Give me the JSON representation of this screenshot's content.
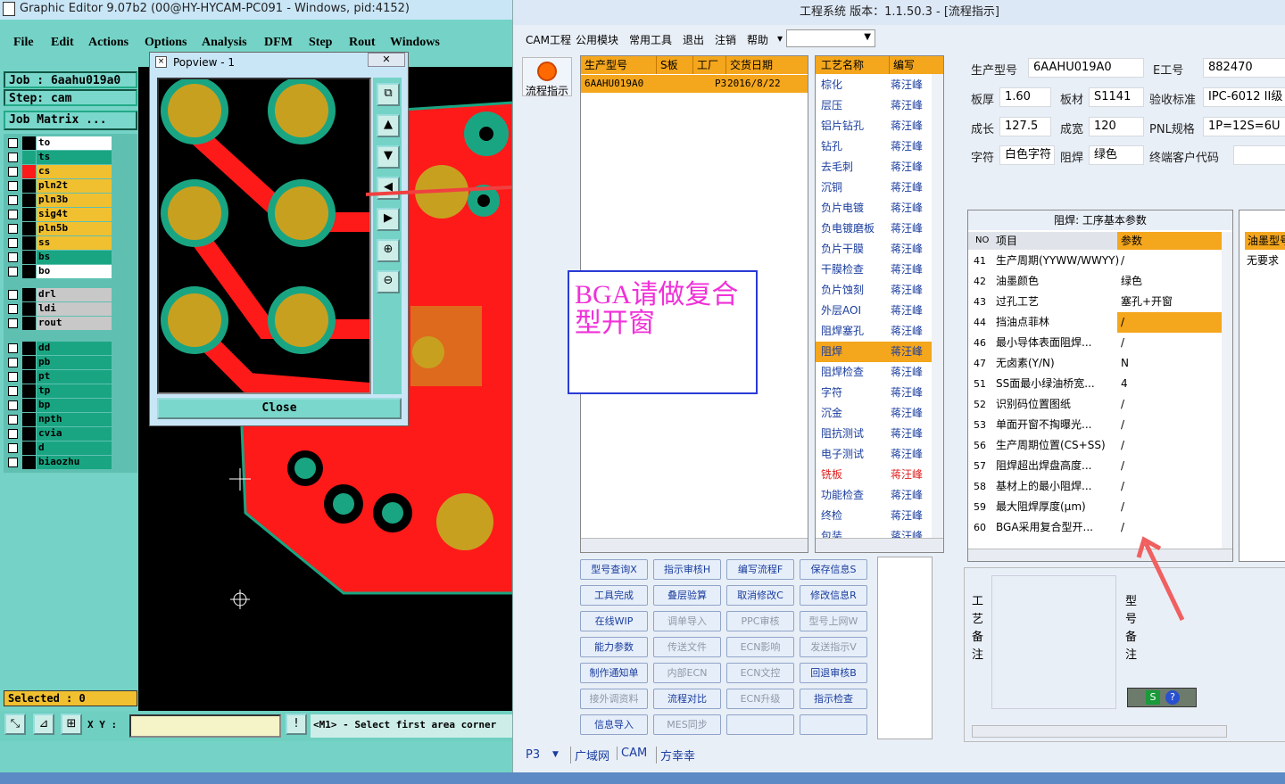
{
  "left_app": {
    "title": "Graphic Editor 9.07b2 (00@HY-HYCAM-PC091 - Windows, pid:4152)",
    "menu": [
      "File",
      "Edit",
      "Actions",
      "Options",
      "Analysis",
      "DFM",
      "Step",
      "Rout",
      "Windows"
    ],
    "job": "Job :  6aahu019a0",
    "step": "Step: cam",
    "job_matrix": "Job Matrix ...",
    "layers_top": [
      {
        "name": "to",
        "color": "#ffffff",
        "swatch": "#000000"
      },
      {
        "name": "ts",
        "color": "#1aa582",
        "swatch": "#1aa582"
      },
      {
        "name": "cs",
        "color": "#f0c030",
        "swatch": "#ff1a1a"
      },
      {
        "name": "pln2t",
        "color": "#f0c030",
        "swatch": "#000000"
      },
      {
        "name": "pln3b",
        "color": "#f0c030",
        "swatch": "#000000"
      },
      {
        "name": "sig4t",
        "color": "#f0c030",
        "swatch": "#000000"
      },
      {
        "name": "pln5b",
        "color": "#f0c030",
        "swatch": "#000000"
      },
      {
        "name": "ss",
        "color": "#f0c030",
        "swatch": "#000000"
      },
      {
        "name": "bs",
        "color": "#1aa582",
        "swatch": "#000000"
      },
      {
        "name": "bo",
        "color": "#ffffff",
        "swatch": "#000000"
      }
    ],
    "layers_drill": [
      {
        "name": "drl",
        "color": "#c8c8c8",
        "swatch": "#000000"
      },
      {
        "name": "ldi",
        "color": "#c8c8c8",
        "swatch": "#000000"
      },
      {
        "name": "rout",
        "color": "#c8c8c8",
        "swatch": "#000000"
      }
    ],
    "layers_misc": [
      {
        "name": "dd",
        "color": "#1aa582",
        "swatch": "#000000"
      },
      {
        "name": "pb",
        "color": "#1aa582",
        "swatch": "#000000"
      },
      {
        "name": "pt",
        "color": "#1aa582",
        "swatch": "#000000"
      },
      {
        "name": "tp",
        "color": "#1aa582",
        "swatch": "#000000"
      },
      {
        "name": "bp",
        "color": "#1aa582",
        "swatch": "#000000"
      },
      {
        "name": "npth",
        "color": "#1aa582",
        "swatch": "#000000"
      },
      {
        "name": "cvia",
        "color": "#1aa582",
        "swatch": "#000000"
      },
      {
        "name": "d",
        "color": "#1aa582",
        "swatch": "#000000"
      },
      {
        "name": "biaozhu",
        "color": "#1aa582",
        "swatch": "#000000"
      }
    ],
    "selected": "Selected : 0",
    "xy_label": "X Y :",
    "status": "<M1> - Select first area corner"
  },
  "popview": {
    "title": "Popview - 1",
    "close": "Close"
  },
  "erp": {
    "title": "工程系统  版本：1.1.50.3 - [流程指示]",
    "menu": [
      "CAM工程",
      "公用模块",
      "常用工具",
      "退出",
      "注销",
      "帮助"
    ],
    "flow_button": "流程指示",
    "orders_header": [
      "生产型号",
      "S板",
      "工厂",
      "交货日期"
    ],
    "orders": [
      {
        "model": "6AAHU019A0",
        "s": "",
        "factory": "P3",
        "date": "2016/8/22"
      }
    ],
    "process_header": [
      "工艺名称",
      "编写"
    ],
    "processes": [
      {
        "name": "棕化",
        "who": "蒋汪峰"
      },
      {
        "name": "层压",
        "who": "蒋汪峰"
      },
      {
        "name": "铝片钻孔",
        "who": "蒋汪峰"
      },
      {
        "name": "钻孔",
        "who": "蒋汪峰"
      },
      {
        "name": "去毛刺",
        "who": "蒋汪峰"
      },
      {
        "name": "沉铜",
        "who": "蒋汪峰"
      },
      {
        "name": "负片电镀",
        "who": "蒋汪峰"
      },
      {
        "name": "负电镀磨板",
        "who": "蒋汪峰"
      },
      {
        "name": "负片干膜",
        "who": "蒋汪峰"
      },
      {
        "name": "干膜检查",
        "who": "蒋汪峰"
      },
      {
        "name": "负片蚀刻",
        "who": "蒋汪峰"
      },
      {
        "name": "外层AOI",
        "who": "蒋汪峰"
      },
      {
        "name": "阻焊塞孔",
        "who": "蒋汪峰"
      },
      {
        "name": "阻焊",
        "who": "蒋汪峰"
      },
      {
        "name": "阻焊检查",
        "who": "蒋汪峰"
      },
      {
        "name": "字符",
        "who": "蒋汪峰"
      },
      {
        "name": "沉金",
        "who": "蒋汪峰"
      },
      {
        "name": "阻抗测试",
        "who": "蒋汪峰"
      },
      {
        "name": "电子测试",
        "who": "蒋汪峰"
      },
      {
        "name": "铣板",
        "who": "蒋汪峰"
      },
      {
        "name": "功能检查",
        "who": "蒋汪峰"
      },
      {
        "name": "终检",
        "who": "蒋汪峰"
      },
      {
        "name": "包装",
        "who": "蒋汪峰"
      }
    ],
    "buttons": [
      [
        "型号查询X",
        "指示审核H",
        "编写流程F",
        "保存信息S"
      ],
      [
        "工具完成",
        "叠层验算",
        "取消修改C",
        "修改信息R"
      ],
      [
        "在线WIP",
        "调单导入",
        "PPC审核",
        "型号上网W"
      ],
      [
        "能力参数",
        "传送文件",
        "ECN影响",
        "发送指示V"
      ],
      [
        "制作通知单",
        "内部ECN",
        "ECN文控",
        "回退审核B"
      ],
      [
        "接外调资料",
        "流程对比",
        "ECN升级",
        "指示检查"
      ],
      [
        "信息导入",
        "MES同步",
        "",
        ""
      ]
    ],
    "buttons_disabled": [
      [
        false,
        false,
        false,
        false
      ],
      [
        false,
        false,
        false,
        false
      ],
      [
        false,
        true,
        true,
        true
      ],
      [
        false,
        true,
        true,
        true
      ],
      [
        false,
        true,
        true,
        false
      ],
      [
        true,
        false,
        true,
        false
      ],
      [
        false,
        true,
        false,
        false
      ]
    ],
    "info": {
      "model_label": "生产型号",
      "model": "6AAHU019A0",
      "eno_label": "E工号",
      "eno": "882470",
      "thick_label": "板厚",
      "thick": "1.60",
      "mat_label": "板材",
      "mat": "S1141",
      "std_label": "验收标准",
      "std": "IPC-6012 II级",
      "len_label": "成长",
      "len": "127.5",
      "wid_label": "成宽",
      "wid": "120",
      "pnl_label": "PNL规格",
      "pnl": "1P=12S=6U",
      "char_label": "字符",
      "char": "白色字符",
      "sm_label": "阻焊",
      "sm": "绿色",
      "cust_label": "终端客户代码",
      "cust": ""
    },
    "params_title": "阻焊: 工序基本参数",
    "params_header": [
      "NO",
      "项目",
      "参数"
    ],
    "params": [
      {
        "no": "41",
        "item": "生产周期(YYWW/WWYY)",
        "val": "/"
      },
      {
        "no": "42",
        "item": "油墨颜色",
        "val": "绿色"
      },
      {
        "no": "43",
        "item": "过孔工艺",
        "val": "塞孔+开窗"
      },
      {
        "no": "44",
        "item": "挡油点菲林",
        "val": "/"
      },
      {
        "no": "46",
        "item": "最小导体表面阻焊...",
        "val": "/"
      },
      {
        "no": "47",
        "item": "无卤素(Y/N)",
        "val": "N"
      },
      {
        "no": "51",
        "item": "SS面最小绿油桥宽...",
        "val": "4"
      },
      {
        "no": "52",
        "item": "识别码位置图纸",
        "val": "/"
      },
      {
        "no": "53",
        "item": "单面开窗不掏曝光...",
        "val": "/"
      },
      {
        "no": "56",
        "item": "生产周期位置(CS+SS)",
        "val": "/"
      },
      {
        "no": "57",
        "item": "阻焊超出焊盘高度...",
        "val": "/"
      },
      {
        "no": "58",
        "item": "基材上的最小阻焊...",
        "val": "/"
      },
      {
        "no": "59",
        "item": "最大阻焊厚度(μm)",
        "val": "/"
      },
      {
        "no": "60",
        "item": "BGA采用复合型开...",
        "val": "/"
      }
    ],
    "side_header": "油墨型号",
    "side_value": "无要求",
    "note_left": [
      "工",
      "艺",
      "备",
      "注"
    ],
    "note_right": [
      "型",
      "号",
      "备",
      "注"
    ],
    "bottom_tabs": [
      "P3",
      "广域网",
      "CAM",
      "方幸幸"
    ]
  },
  "callout": "BGA请做复合型开窗"
}
